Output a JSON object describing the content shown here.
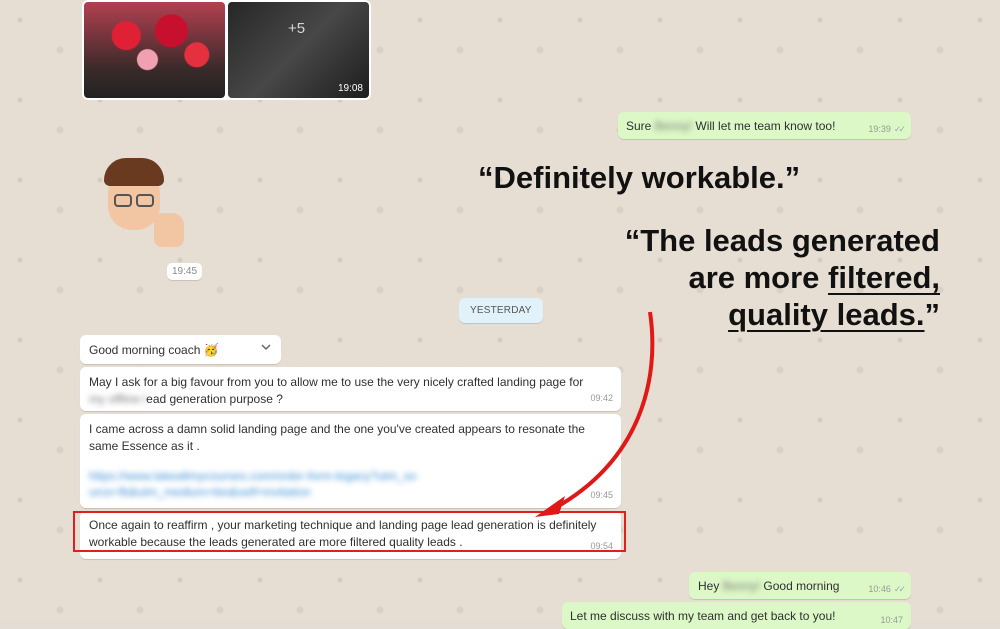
{
  "media": {
    "time": "19:08",
    "more_count": "+5"
  },
  "messages": {
    "sure": {
      "text_a": "Sure ",
      "blurred": "Benny!",
      "text_b": " Will let me team know too!",
      "time": "19:39"
    },
    "emoji_time": "19:45",
    "day_separator": "YESTERDAY",
    "greeting": {
      "text": "Good morning coach 🥳"
    },
    "favour": {
      "text_a": "May I ask for a big favour from you to allow me to use the very nicely crafted landing page for",
      "blurred": "my offline l",
      "text_b": "ead generation purpose ?",
      "time": "09:42"
    },
    "solid": {
      "text": "I came across a damn solid landing page and the one you've created appears to resonate the same Essence as it .",
      "link": "https://www.takeallmycourses.com/order-form-legacy?utm_source=fb&utm_medium=bio&self=invitation",
      "time": "09:45"
    },
    "reaffirm": {
      "text": "Once again to reaffirm , your marketing technique and landing page lead generation is definitely workable because the leads generated are more filtered quality leads .",
      "time": "09:54"
    },
    "hey": {
      "text_a": "Hey ",
      "blurred": "Benny!",
      "text_b": " Good morning",
      "time": "10:46"
    },
    "discuss": {
      "text": "Let me discuss with my team and get back to you!",
      "time": "10:47"
    }
  },
  "quotes": {
    "q1": "“Definitely workable.”",
    "q2_line1": "“The leads generated",
    "q2_line2_a": "are more ",
    "q2_line2_b": "filtered,",
    "q2_line3": "quality leads.",
    "q2_close": "”"
  },
  "colors": {
    "incoming": "#ffffff",
    "outgoing": "#dcf8c6",
    "highlight": "#e02020"
  }
}
